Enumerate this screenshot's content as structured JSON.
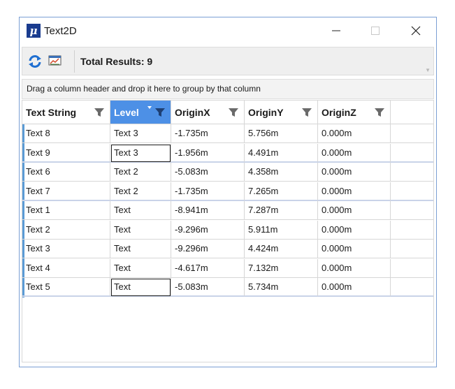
{
  "window": {
    "title": "Text2D",
    "app_icon_glyph": "μ",
    "controls": [
      "minimize-icon",
      "maximize-icon",
      "close-icon"
    ]
  },
  "toolbar": {
    "refresh_icon": "refresh-icon",
    "chart_icon": "chart-icon",
    "total_results_label": "Total Results: 9"
  },
  "group_panel": {
    "hint": "Drag a column header and drop it here to group by that column"
  },
  "grid": {
    "columns": [
      {
        "key": "text_string",
        "label": "Text String",
        "filter": true,
        "sorted": false
      },
      {
        "key": "level",
        "label": "Level",
        "filter": true,
        "sorted": true
      },
      {
        "key": "origin_x",
        "label": "OriginX",
        "filter": true,
        "sorted": false
      },
      {
        "key": "origin_y",
        "label": "OriginY",
        "filter": true,
        "sorted": false
      },
      {
        "key": "origin_z",
        "label": "OriginZ",
        "filter": true,
        "sorted": false
      }
    ],
    "rows": [
      [
        "Text 8",
        "Text 3",
        "-1.735m",
        "5.756m",
        "0.000m"
      ],
      [
        "Text 9",
        "Text 3",
        "-1.956m",
        "4.491m",
        "0.000m"
      ],
      [
        "Text 6",
        "Text 2",
        "-5.083m",
        "4.358m",
        "0.000m"
      ],
      [
        "Text 7",
        "Text 2",
        "-1.735m",
        "7.265m",
        "0.000m"
      ],
      [
        "Text 1",
        "Text",
        "-8.941m",
        "7.287m",
        "0.000m"
      ],
      [
        "Text 2",
        "Text",
        "-9.296m",
        "5.911m",
        "0.000m"
      ],
      [
        "Text 3",
        "Text",
        "-9.296m",
        "4.424m",
        "0.000m"
      ],
      [
        "Text 4",
        "Text",
        "-4.617m",
        "7.132m",
        "0.000m"
      ],
      [
        "Text 5",
        "Text",
        "-5.083m",
        "5.734m",
        "0.000m"
      ]
    ],
    "selected_cells": [
      [
        1,
        1
      ],
      [
        8,
        1
      ]
    ]
  },
  "colors": {
    "accent": "#4d90e6",
    "row_indicator": "#5b9bd5",
    "window_border": "#7a9fd4"
  }
}
